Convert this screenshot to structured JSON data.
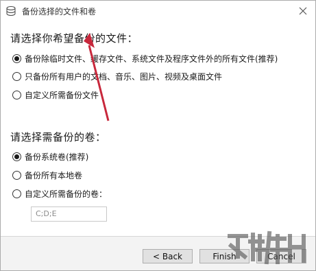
{
  "window": {
    "title": "备份选择的文件和卷"
  },
  "files_section": {
    "heading": "请选择你希望备份的文件：",
    "options": [
      {
        "label": "备份除临时文件、缓存文件、系统文件及程序文件外的所有文件(推荐)",
        "checked": true
      },
      {
        "label": "只备份所有用户的文档、音乐、图片、视频及桌面文件",
        "checked": false
      },
      {
        "label": "自定义所需备份文件",
        "checked": false
      }
    ]
  },
  "volumes_section": {
    "heading": "请选择需备份的卷：",
    "options": [
      {
        "label": "备份系统卷(推荐)",
        "checked": true
      },
      {
        "label": "备份所有本地卷",
        "checked": false
      },
      {
        "label": "自定义所需备份的卷：",
        "checked": false
      }
    ],
    "custom_value": "C;D;E"
  },
  "buttons": {
    "back": "< Back",
    "finish": "Finish",
    "cancel": "Cancel"
  },
  "colors": {
    "annotation_arrow": "#c8283c",
    "watermark": "#5a5a5a"
  },
  "icons": {
    "title": "database-icon",
    "close": "close-icon",
    "annotation": "red-arrow-annotation",
    "watermark": "site-watermark-logo"
  }
}
